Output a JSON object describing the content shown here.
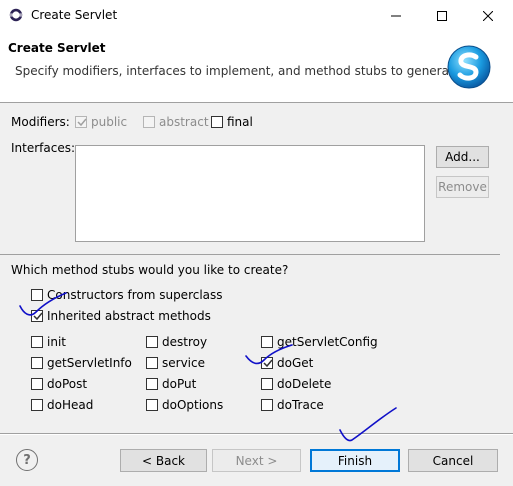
{
  "window": {
    "title": "Create Servlet"
  },
  "header": {
    "title": "Create Servlet",
    "description": "Specify modifiers, interfaces to implement, and method stubs to generate.",
    "logo_icon": "servlet-s-icon"
  },
  "modifiers": {
    "label": "Modifiers:",
    "public": {
      "label": "public",
      "checked": true,
      "enabled": false
    },
    "abstract": {
      "label": "abstract",
      "checked": false,
      "enabled": false
    },
    "final": {
      "label": "final",
      "checked": false,
      "enabled": true
    }
  },
  "interfaces": {
    "label": "Interfaces:",
    "items": [],
    "add_label": "Add...",
    "remove_label": "Remove"
  },
  "stubs": {
    "question": "Which method stubs would you like to create?",
    "constructors": {
      "label": "Constructors from superclass",
      "checked": false
    },
    "inherited": {
      "label": "Inherited abstract methods",
      "checked": true
    },
    "methods": [
      {
        "label": "init",
        "checked": false
      },
      {
        "label": "destroy",
        "checked": false
      },
      {
        "label": "getServletConfig",
        "checked": false
      },
      {
        "label": "getServletInfo",
        "checked": false
      },
      {
        "label": "service",
        "checked": false
      },
      {
        "label": "doGet",
        "checked": true
      },
      {
        "label": "doPost",
        "checked": false
      },
      {
        "label": "doPut",
        "checked": false
      },
      {
        "label": "doDelete",
        "checked": false
      },
      {
        "label": "doHead",
        "checked": false
      },
      {
        "label": "doOptions",
        "checked": false
      },
      {
        "label": "doTrace",
        "checked": false
      }
    ]
  },
  "footer": {
    "help_glyph": "?",
    "back_label": "< Back",
    "next_label": "Next >",
    "finish_label": "Finish",
    "cancel_label": "Cancel"
  },
  "colors": {
    "accent": "#0078d7",
    "annotation_ink": "#1010c8",
    "check": "#333333"
  }
}
